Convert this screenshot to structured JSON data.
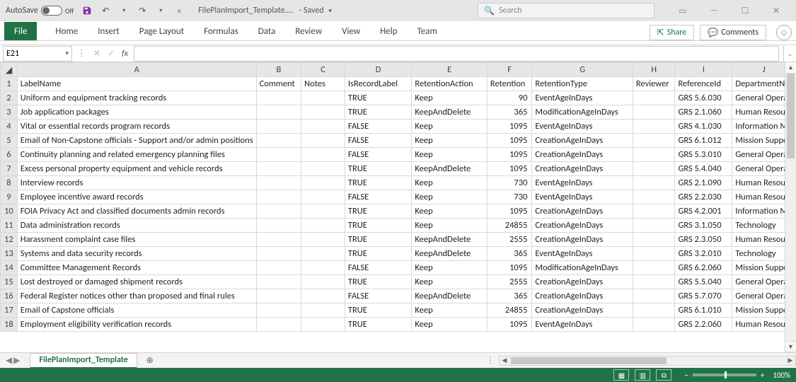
{
  "titlebar": {
    "autosave_label": "AutoSave",
    "autosave_state": "Off",
    "filename": "FilePlanImport_Template.…",
    "save_state": "- Saved",
    "search_placeholder": "Search"
  },
  "ribbon": {
    "file": "File",
    "tabs": [
      "Home",
      "Insert",
      "Page Layout",
      "Formulas",
      "Data",
      "Review",
      "View",
      "Help",
      "Team"
    ],
    "share": "Share",
    "comments": "Comments"
  },
  "addressbar": {
    "cellref": "E21",
    "fx_label": "fx"
  },
  "sheet": {
    "columns": [
      "A",
      "B",
      "C",
      "D",
      "E",
      "F",
      "G",
      "H",
      "I",
      "J"
    ],
    "headers": [
      "LabelName",
      "Comment",
      "Notes",
      "IsRecordLabel",
      "RetentionAction",
      "Retention",
      "RetentionType",
      "Reviewer",
      "ReferenceId",
      "DepartmentNa"
    ],
    "rows": [
      {
        "r": "2",
        "A": "Uniform and equipment tracking records",
        "D": "TRUE",
        "E": "Keep",
        "F": "90",
        "G": "EventAgeInDays",
        "I": "GRS 5.6.030",
        "J": "General Opera"
      },
      {
        "r": "3",
        "A": "Job application packages",
        "D": "TRUE",
        "E": "KeepAndDelete",
        "F": "365",
        "G": "ModificationAgeInDays",
        "I": "GRS 2.1.060",
        "J": "Human Resour"
      },
      {
        "r": "4",
        "A": "Vital or essential records program records",
        "D": "FALSE",
        "E": "Keep",
        "F": "1095",
        "G": "EventAgeInDays",
        "I": "GRS 4.1.030",
        "J": "Information M"
      },
      {
        "r": "5",
        "A": "Email of Non-Capstone officials - Support and/or admin positions",
        "D": "FALSE",
        "E": "Keep",
        "F": "1095",
        "G": "CreationAgeInDays",
        "I": "GRS 6.1.012",
        "J": "Mission Suppo"
      },
      {
        "r": "6",
        "A": "Continuity planning and related emergency planning files",
        "D": "FALSE",
        "E": "Keep",
        "F": "1095",
        "G": "CreationAgeInDays",
        "I": "GRS 5.3.010",
        "J": "General Opera"
      },
      {
        "r": "7",
        "A": "Excess personal property equipment and vehicle records",
        "D": "TRUE",
        "E": "KeepAndDelete",
        "F": "1095",
        "G": "CreationAgeInDays",
        "I": "GRS 5.4.040",
        "J": "General Opera"
      },
      {
        "r": "8",
        "A": "Interview records",
        "D": "TRUE",
        "E": "Keep",
        "F": "730",
        "G": "EventAgeInDays",
        "I": "GRS 2.1.090",
        "J": "Human Resour"
      },
      {
        "r": "9",
        "A": "Employee incentive award records",
        "D": "FALSE",
        "E": "Keep",
        "F": "730",
        "G": "EventAgeInDays",
        "I": "GRS 2.2.030",
        "J": "Human Resour"
      },
      {
        "r": "10",
        "A": "FOIA Privacy Act and classified documents admin records",
        "D": "TRUE",
        "E": "Keep",
        "F": "1095",
        "G": "CreationAgeInDays",
        "I": "GRS 4.2.001",
        "J": "Information M"
      },
      {
        "r": "11",
        "A": "Data administration records",
        "D": "TRUE",
        "E": "Keep",
        "F": "24855",
        "G": "CreationAgeInDays",
        "I": "GRS 3.1.050",
        "J": "Technology"
      },
      {
        "r": "12",
        "A": "Harassment complaint case files",
        "D": "TRUE",
        "E": "KeepAndDelete",
        "F": "2555",
        "G": "CreationAgeInDays",
        "I": "GRS 2.3.050",
        "J": "Human Resour"
      },
      {
        "r": "13",
        "A": "Systems and data security records",
        "D": "TRUE",
        "E": "KeepAndDelete",
        "F": "365",
        "G": "EventAgeInDays",
        "I": "GRS 3.2.010",
        "J": "Technology"
      },
      {
        "r": "14",
        "A": "Committee Management Records",
        "D": "FALSE",
        "E": "Keep",
        "F": "1095",
        "G": "ModificationAgeInDays",
        "I": "GRS 6.2.060",
        "J": "Mission Suppo"
      },
      {
        "r": "15",
        "A": "Lost destroyed or damaged shipment records",
        "D": "TRUE",
        "E": "Keep",
        "F": "2555",
        "G": "CreationAgeInDays",
        "I": "GRS 5.5.040",
        "J": "General Opera"
      },
      {
        "r": "16",
        "A": "Federal Register notices other than proposed and final rules",
        "D": "FALSE",
        "E": "KeepAndDelete",
        "F": "365",
        "G": "CreationAgeInDays",
        "I": "GRS 5.7.070",
        "J": "General Opera"
      },
      {
        "r": "17",
        "A": "Email of Capstone officials",
        "D": "TRUE",
        "E": "Keep",
        "F": "24855",
        "G": "CreationAgeInDays",
        "I": "GRS 6.1.010",
        "J": "Mission Suppo"
      },
      {
        "r": "18",
        "A": "Employment eligibility verification records",
        "D": "TRUE",
        "E": "Keep",
        "F": "1095",
        "G": "EventAgeInDays",
        "I": "GRS 2.2.060",
        "J": "Human Resour"
      }
    ]
  },
  "tabstrip": {
    "sheet_name": "FilePlanImport_Template"
  },
  "status": {
    "zoom": "100%"
  }
}
